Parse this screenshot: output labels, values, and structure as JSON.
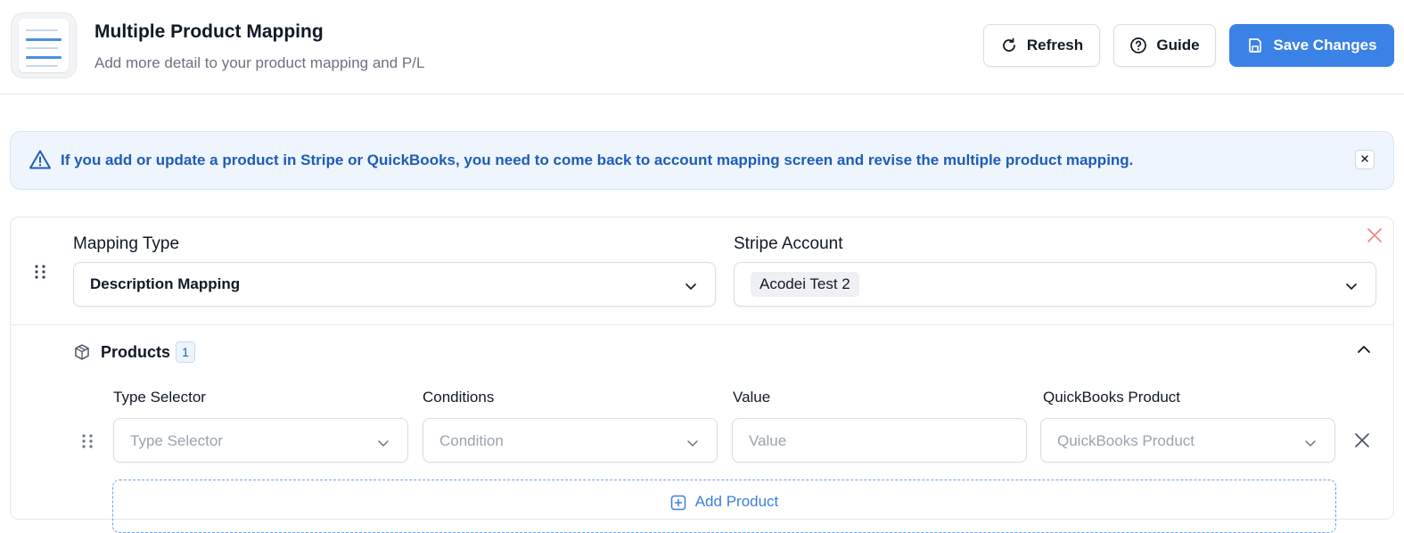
{
  "header": {
    "title": "Multiple Product Mapping",
    "subtitle": "Add more detail to your product mapping and P/L",
    "refresh_label": "Refresh",
    "guide_label": "Guide",
    "save_label": "Save Changes"
  },
  "alert": {
    "message": "If you add or update a product in Stripe or QuickBooks, you need to come back to account mapping screen and revise the multiple product mapping."
  },
  "mapping": {
    "mapping_type_label": "Mapping Type",
    "mapping_type_value": "Description Mapping",
    "stripe_account_label": "Stripe Account",
    "stripe_account_value": "Acodei Test 2"
  },
  "products": {
    "title": "Products",
    "count": "1",
    "columns": [
      "Type Selector",
      "Conditions",
      "Value",
      "QuickBooks Product"
    ],
    "row": {
      "type_selector_placeholder": "Type Selector",
      "condition_placeholder": "Condition",
      "value_placeholder": "Value",
      "quickbooks_product_placeholder": "QuickBooks Product"
    },
    "add_label": "Add Product"
  },
  "colors": {
    "primary": "#3b82e6",
    "alert_background": "#eef5fd",
    "alert_text": "#1e5cb8",
    "remove_red": "#ef8a80"
  },
  "icons": {
    "refresh": "refresh-icon",
    "guide": "help-circle-icon",
    "save": "save-icon",
    "alert": "warning-triangle-icon",
    "products": "package-icon"
  }
}
